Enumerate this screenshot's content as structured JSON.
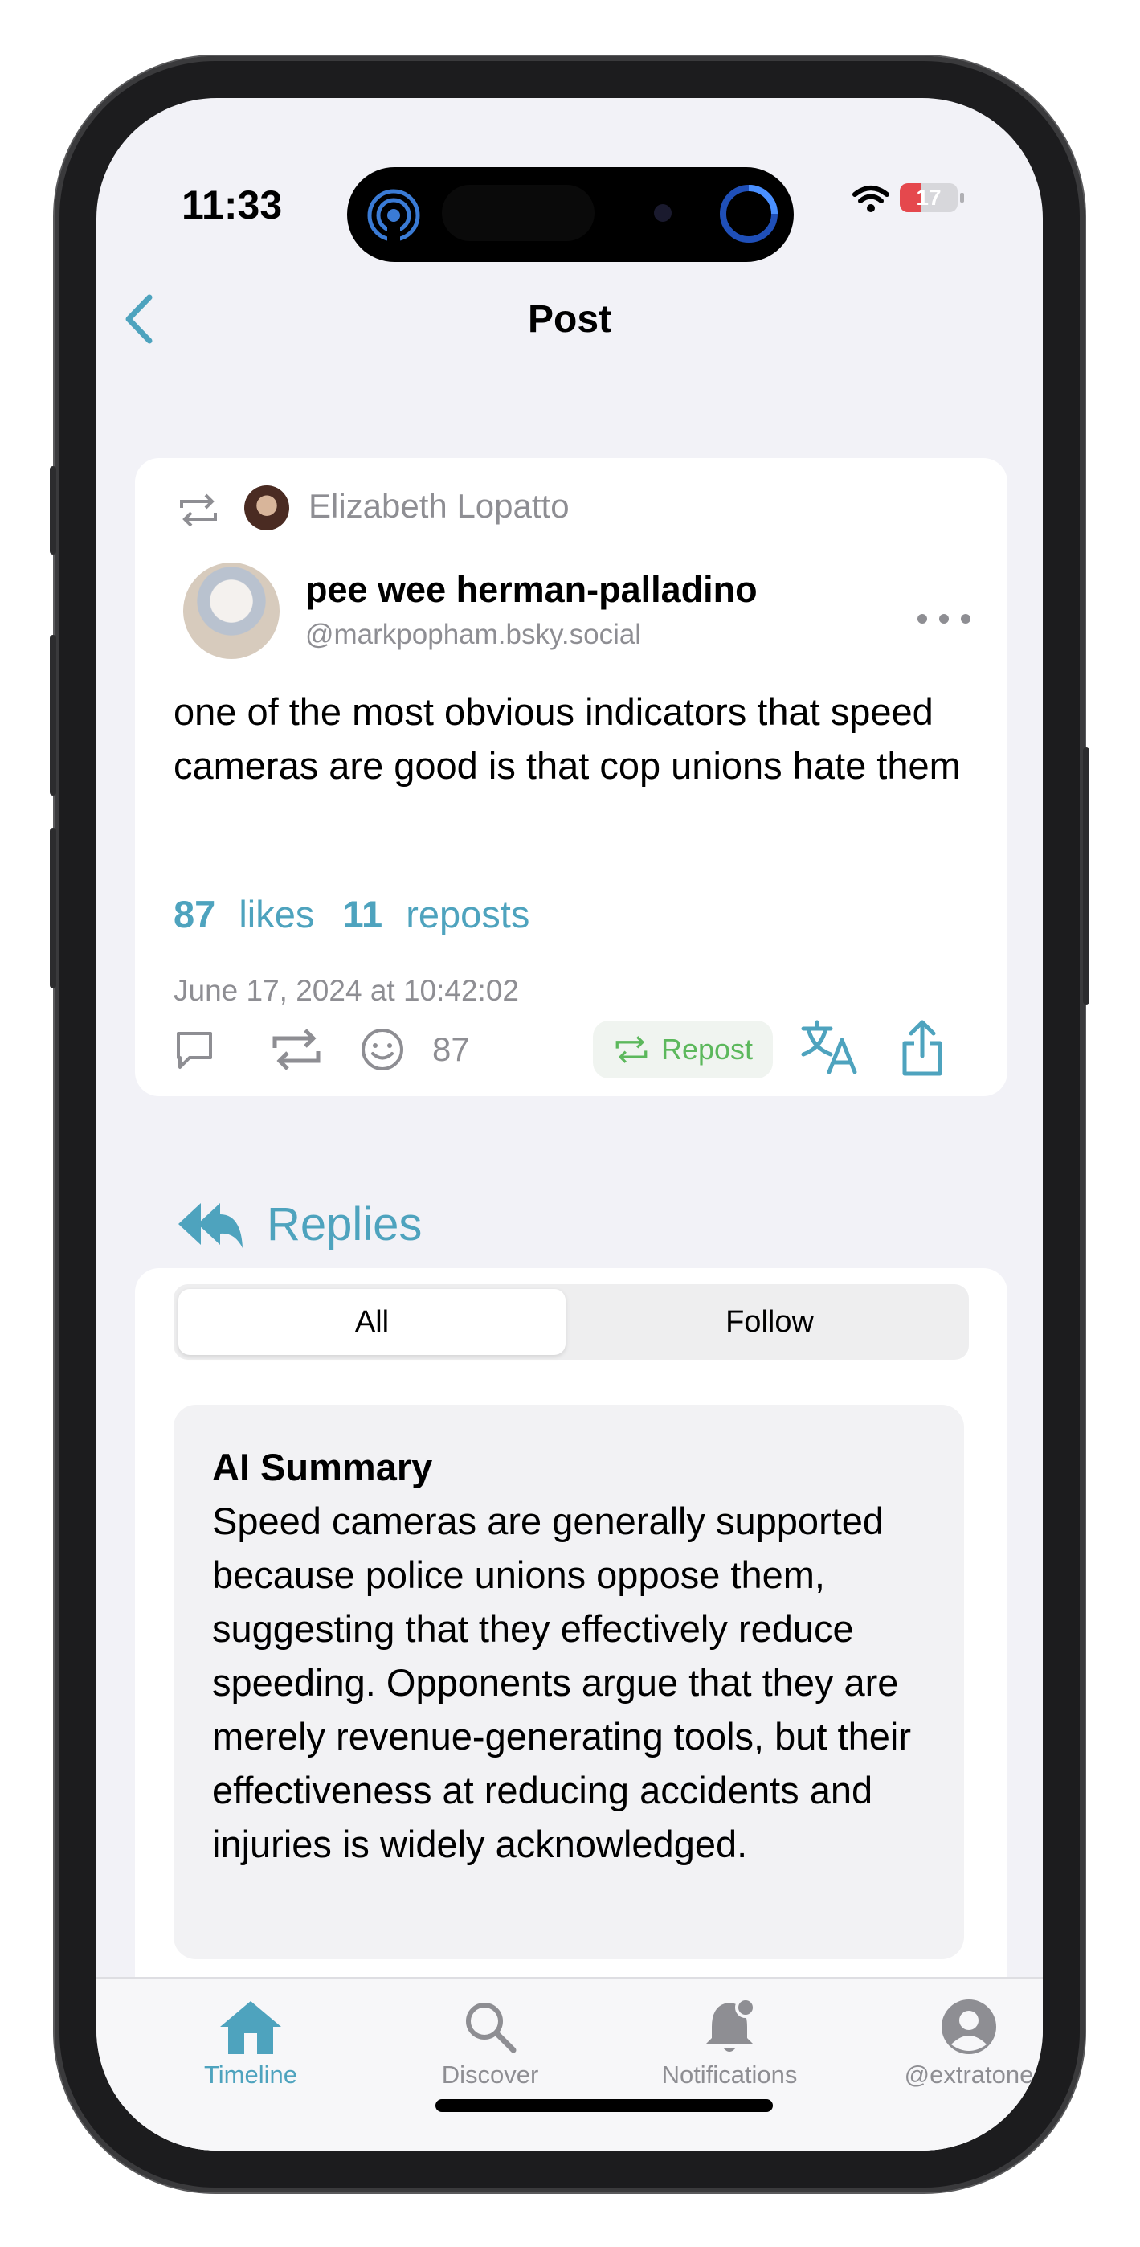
{
  "status_bar": {
    "time": "11:33",
    "battery": "17"
  },
  "nav": {
    "title": "Post"
  },
  "post": {
    "reposted_by": "Elizabeth Lopatto",
    "author_name": "pee wee herman-palladino",
    "author_handle": "@markpopham.bsky.social",
    "text": "one of the most obvious indicators that speed cameras are good is that cop unions hate them",
    "likes_count": "87",
    "likes_label": "likes",
    "reposts_count": "11",
    "reposts_label": "reposts",
    "timestamp": "June 17, 2024 at 10:42:02",
    "reaction_count": "87",
    "repost_button_label": "Repost"
  },
  "replies": {
    "heading": "Replies",
    "segments": [
      "All",
      "Follow"
    ],
    "selected_segment": "All",
    "summary_title": "AI Summary",
    "summary_text": "Speed cameras are generally supported because police unions oppose them, suggesting that they effectively reduce speeding. Opponents argue that they are merely revenue-generating tools, but their effectiveness at reducing accidents and injuries is widely acknowledged."
  },
  "tabbar": {
    "items": [
      {
        "label": "Timeline",
        "icon": "house-icon",
        "active": true
      },
      {
        "label": "Discover",
        "icon": "magnifier-icon",
        "active": false
      },
      {
        "label": "Notifications",
        "icon": "bell-icon",
        "active": false
      },
      {
        "label": "@extratone",
        "icon": "person-icon",
        "active": false
      }
    ]
  },
  "colors": {
    "accent": "#4ea3be",
    "repost_green": "#5cb85c",
    "battery_low": "#e5484d"
  }
}
